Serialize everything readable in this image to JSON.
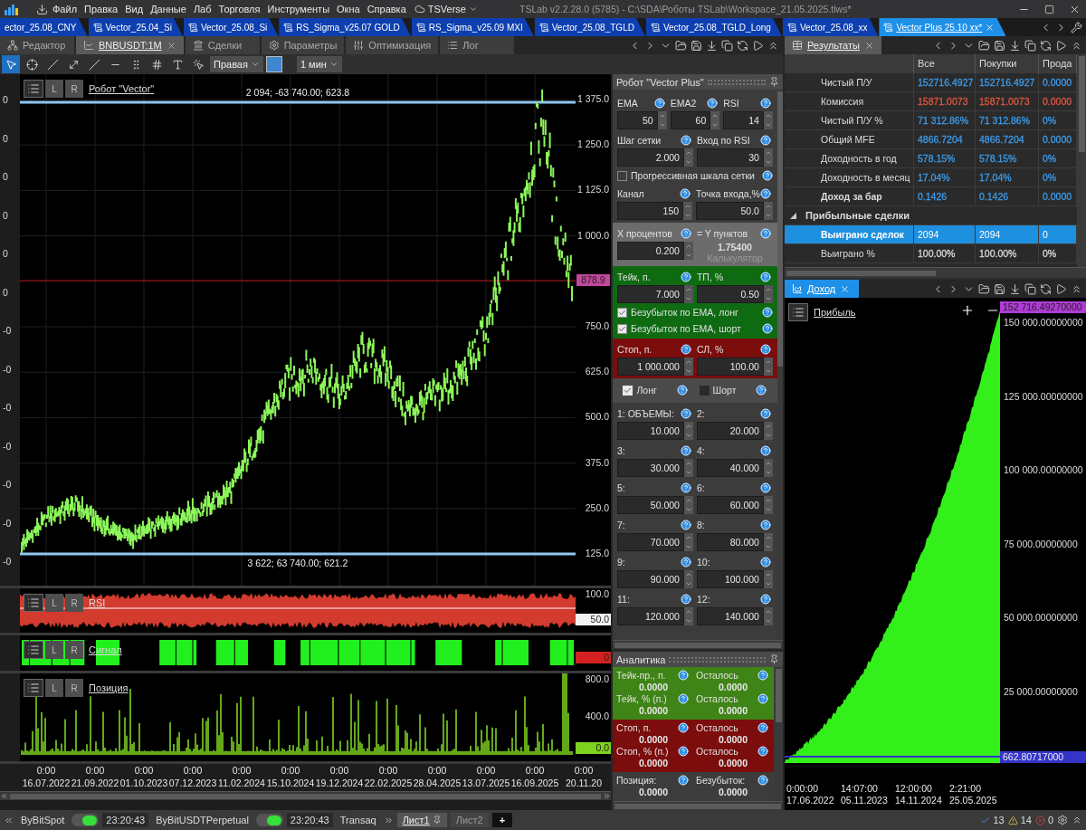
{
  "menu": {
    "items": [
      "Файл",
      "Правка",
      "Вид",
      "Данные",
      "Лаб",
      "Торговля",
      "Инструменты",
      "Окна",
      "Справка"
    ],
    "cloud": "TSVerse"
  },
  "window": {
    "title": "TSLab v2.2.28.0 (5785) - C:\\SDA\\Роботы TSLab\\Workspace_21.05.2025.tlws*"
  },
  "doc_tabs": [
    {
      "label": "ector_25.08_CNY",
      "icon": false,
      "selected": false
    },
    {
      "label": "Vector_25.04_Si",
      "icon": true,
      "selected": false
    },
    {
      "label": "Vector_25.08_Si",
      "icon": true,
      "selected": false
    },
    {
      "label": "RS_Sigma_v25.07 GOLD",
      "icon": true,
      "selected": false
    },
    {
      "label": "RS_Sigma_v25.09 MXI",
      "icon": true,
      "selected": false
    },
    {
      "label": "Vector_25.08_TGLD",
      "icon": true,
      "selected": false
    },
    {
      "label": "Vector_25.08_TGLD_Long",
      "icon": true,
      "selected": false
    },
    {
      "label": "Vector_25.08_xx",
      "icon": true,
      "selected": false
    },
    {
      "label": "Vector Plus 25.10 xx*",
      "icon": true,
      "selected": true
    }
  ],
  "pane_tabs": [
    {
      "label": "Редактор",
      "selected": false
    },
    {
      "label": "BNBUSDT:1M",
      "selected": true
    },
    {
      "label": "Сделки",
      "selected": false
    },
    {
      "label": "Параметры",
      "selected": false
    },
    {
      "label": "Оптимизация",
      "selected": false
    },
    {
      "label": "Лог",
      "selected": false
    }
  ],
  "chart_toolbar": {
    "axis": "Правая",
    "interval": "1 мин",
    "color": "#3f86d0"
  },
  "main_chart": {
    "title": "Робот \"Vector\"",
    "buttons": [
      "L",
      "R"
    ],
    "upper_line": "2 094; -63 740.00; 623.8",
    "lower_line": "3 622; 63 740.00; 621.2",
    "left_ticks": [
      "0",
      "0",
      "0",
      "0",
      "0",
      "0",
      "-0",
      "-0",
      "-0",
      "-0",
      "-0",
      "-0",
      "-0"
    ],
    "price_ticks": [
      "1 375.0",
      "1 250.0",
      "1 125.0",
      "1 000.0",
      "750.0",
      "625.0",
      "500.0",
      "375.0",
      "250.0",
      "125.0"
    ],
    "current_price": {
      "value": "878.9",
      "color": "#c2479c"
    }
  },
  "indicator_panes": [
    {
      "kind": "rsi",
      "title": "RSI",
      "buttons": [
        "L",
        "R"
      ],
      "ticks": [
        "100.0"
      ],
      "badge": {
        "value": "50.0",
        "color": "#f2f2f2"
      }
    },
    {
      "kind": "signal",
      "title": "Сигнал",
      "buttons": [
        "L",
        "R"
      ],
      "badge": {
        "value": "0",
        "color": "#d42020"
      }
    },
    {
      "kind": "position",
      "title": "Позиция",
      "buttons": [
        "L",
        "R"
      ],
      "ticks": [
        "800.0",
        "400.0"
      ],
      "badge": {
        "value": "0.0",
        "color": "#7ed321"
      }
    }
  ],
  "x_axis": [
    {
      "time": "0:00",
      "date": "16.07.2022"
    },
    {
      "time": "0:00",
      "date": "21.09.2022"
    },
    {
      "time": "0:00",
      "date": "01.10.2023"
    },
    {
      "time": "0:00",
      "date": "07.12.2023"
    },
    {
      "time": "0:00",
      "date": "11.02.2024"
    },
    {
      "time": "0:00",
      "date": "15.10.2024"
    },
    {
      "time": "0:00",
      "date": "19.12.2024"
    },
    {
      "time": "0:00",
      "date": "22.02.2025"
    },
    {
      "time": "0:00",
      "date": "28.04.2025"
    },
    {
      "time": "0:00",
      "date": "13.07.2025"
    },
    {
      "time": "0:00",
      "date": "16.09.2025"
    },
    {
      "time": "0:00",
      "date": "20.11.20"
    }
  ],
  "params": {
    "title": "Робот \"Vector Plus\"",
    "sections": [
      {
        "color": "#3c3c3c",
        "rows": [
          {
            "kind": "fields",
            "cells": [
              {
                "kind": "field",
                "label": "EMA",
                "value": "50"
              },
              {
                "kind": "field",
                "label": "EMA2",
                "value": "60"
              },
              {
                "kind": "field",
                "label": "RSI",
                "value": "14"
              }
            ]
          },
          {
            "kind": "fields",
            "cells": [
              {
                "kind": "field",
                "label": "Шаг сетки",
                "value": "2.000"
              },
              {
                "kind": "field",
                "label": "Вход по RSI",
                "value": "30"
              }
            ]
          },
          {
            "kind": "checkbox",
            "label": "Прогрессивная шкала сетки",
            "checked": false
          },
          {
            "kind": "fields",
            "cells": [
              {
                "kind": "field",
                "label": "Канал",
                "value": "150"
              },
              {
                "kind": "field",
                "label": "Точка входа,%",
                "value": "50.0"
              }
            ]
          }
        ]
      },
      {
        "color": "#6c6c6c",
        "rows": [
          {
            "kind": "fields",
            "cells": [
              {
                "kind": "field",
                "label": "X процентов",
                "value": "0.200"
              },
              {
                "kind": "calc",
                "label": "= Y пунктов",
                "value": "1.75400",
                "button": "Калькулятор"
              }
            ]
          }
        ]
      },
      {
        "color": "#0f6b12",
        "rows": [
          {
            "kind": "fields",
            "cells": [
              {
                "kind": "field",
                "label": "Тейк, п.",
                "value": "7.000"
              },
              {
                "kind": "field",
                "label": "ТП, %",
                "value": "0.50"
              }
            ]
          },
          {
            "kind": "checkbox",
            "label": "Безубыток по EMA, лонг",
            "checked": true
          },
          {
            "kind": "checkbox",
            "label": "Безубыток по EMA, шорт",
            "checked": true
          }
        ]
      },
      {
        "color": "#7b0d0d",
        "rows": [
          {
            "kind": "fields",
            "cells": [
              {
                "kind": "field",
                "label": "Стоп, п.",
                "value": "1 000.000"
              },
              {
                "kind": "field",
                "label": "СЛ, %",
                "value": "100.00"
              }
            ]
          }
        ]
      },
      {
        "color": "#4a4a4a",
        "rows": [
          {
            "kind": "toggles",
            "items": [
              {
                "label": "Лонг",
                "checked": true
              },
              {
                "label": "Шорт",
                "checked": false
              }
            ]
          }
        ]
      },
      {
        "color": "#3c3c3c",
        "rows": [
          {
            "kind": "fields",
            "cells": [
              {
                "kind": "field",
                "label": "1: ОБЪЕМЫ:",
                "value": "10.000"
              },
              {
                "kind": "field",
                "label": "2:",
                "value": "20.000"
              }
            ]
          },
          {
            "kind": "fields",
            "cells": [
              {
                "kind": "field",
                "label": "3:",
                "value": "30.000"
              },
              {
                "kind": "field",
                "label": "4:",
                "value": "40.000"
              }
            ]
          },
          {
            "kind": "fields",
            "cells": [
              {
                "kind": "field",
                "label": "5:",
                "value": "50.000"
              },
              {
                "kind": "field",
                "label": "6:",
                "value": "60.000"
              }
            ]
          },
          {
            "kind": "fields",
            "cells": [
              {
                "kind": "field",
                "label": "7:",
                "value": "70.000"
              },
              {
                "kind": "field",
                "label": "8:",
                "value": "80.000"
              }
            ]
          },
          {
            "kind": "fields",
            "cells": [
              {
                "kind": "field",
                "label": "9:",
                "value": "90.000"
              },
              {
                "kind": "field",
                "label": "10:",
                "value": "100.000"
              }
            ]
          },
          {
            "kind": "fields",
            "cells": [
              {
                "kind": "field",
                "label": "11:",
                "value": "120.000"
              },
              {
                "kind": "field",
                "label": "12:",
                "value": "140.000"
              }
            ]
          }
        ]
      }
    ]
  },
  "analytics": {
    "title": "Аналитика",
    "sections": [
      {
        "color": "#3f8416",
        "items": [
          {
            "label": "Тейк-пр., п.",
            "value": "0.0000"
          },
          {
            "label": "Осталось",
            "value": "0.0000"
          },
          {
            "label": "Тейк, % (п.)",
            "value": "0.0000"
          },
          {
            "label": "Осталось",
            "value": "0.0000"
          }
        ]
      },
      {
        "color": "#7b0d0d",
        "items": [
          {
            "label": "Стоп, п.",
            "value": "0.0000"
          },
          {
            "label": "Осталось",
            "value": "0.0000"
          },
          {
            "label": "Стоп, % (п.)",
            "value": "0.0000"
          },
          {
            "label": "Осталось",
            "value": "0.0000"
          }
        ]
      },
      {
        "color": "#3c3c3c",
        "items": [
          {
            "label": "Позиция:",
            "value": "0.0000"
          },
          {
            "label": "Безубыток:",
            "value": "0.0000"
          }
        ]
      }
    ]
  },
  "results": {
    "tab": "Результаты",
    "columns": [
      "Все",
      "Покупки",
      "Прода"
    ],
    "rows": [
      {
        "kind": "metric",
        "label": "Чистый П/У",
        "values": [
          "152716.4927",
          "152716.4927",
          "0.0000"
        ],
        "color": "#3d9be9",
        "bold": false,
        "selected": false
      },
      {
        "kind": "metric",
        "label": "Комиссия",
        "values": [
          "15871.0073",
          "15871.0073",
          "0.0000"
        ],
        "color": "#e0573f",
        "bold": false,
        "selected": false
      },
      {
        "kind": "metric",
        "label": "Чистый П/У %",
        "values": [
          "71 312.86%",
          "71 312.86%",
          "0%"
        ],
        "color": "#3d9be9",
        "bold": false,
        "selected": false
      },
      {
        "kind": "metric",
        "label": "Общий MFE",
        "values": [
          "4866.7204",
          "4866.7204",
          "0.0000"
        ],
        "color": "#3d9be9",
        "bold": false,
        "selected": false
      },
      {
        "kind": "metric",
        "label": "Доходность в год",
        "values": [
          "578.15%",
          "578.15%",
          "0%"
        ],
        "color": "#3d9be9",
        "bold": false,
        "selected": false
      },
      {
        "kind": "metric",
        "label": "Доходность в месяц",
        "values": [
          "17.04%",
          "17.04%",
          "0%"
        ],
        "color": "#3d9be9",
        "bold": false,
        "selected": false
      },
      {
        "kind": "metric",
        "label": "Доход за бар",
        "values": [
          "0.1426",
          "0.1426",
          "0.0000"
        ],
        "color": "#3d9be9",
        "bold": true,
        "selected": false
      },
      {
        "kind": "group",
        "label": "Прибыльные сделки",
        "expanded": true,
        "selected": false
      },
      {
        "kind": "metric",
        "label": "Выиграно сделок",
        "values": [
          "2094",
          "2094",
          "0"
        ],
        "bold": true,
        "selected": true
      },
      {
        "kind": "metric",
        "label": "Выиграно %",
        "values": [
          "100.00%",
          "100.00%",
          "0%"
        ],
        "color": "#d8d8d8",
        "bold": false,
        "selected": false
      }
    ]
  },
  "income": {
    "tab": "Доход",
    "title": "Прибыль",
    "ticks": [
      "150 000.00000000",
      "125 000.00000000",
      "100 000.00000000",
      "75 000.00000000",
      "50 000.00000000",
      "25 000.00000000"
    ],
    "top_badge": {
      "value": "152 716.49270000",
      "color": "#b13bd6"
    },
    "bottom_badge": {
      "value": "662.80717000",
      "color": "#3434c8"
    },
    "x_axis": [
      {
        "time": "0:00:00",
        "date": "17.06.2022"
      },
      {
        "time": "14:07:00",
        "date": "05.11.2023"
      },
      {
        "time": "12:00:00",
        "date": "14.11.2024"
      },
      {
        "time": "2:21:00",
        "date": "25.05.2025"
      }
    ]
  },
  "status_bar": {
    "connections": [
      {
        "name": "ByBitSpot",
        "on": true,
        "time": "23:20:43"
      },
      {
        "name": "ByBitUSDTPerpetual",
        "on": true,
        "time": "23:20:43"
      },
      {
        "name": "Transaq"
      }
    ],
    "sheets": [
      {
        "label": "Лист1",
        "selected": true
      },
      {
        "label": "Лист2",
        "selected": false
      }
    ],
    "add": "+",
    "counters": [
      {
        "kind": "ok",
        "value": "13"
      },
      {
        "kind": "warning",
        "value": "14"
      },
      {
        "kind": "error",
        "value": "0"
      }
    ]
  }
}
